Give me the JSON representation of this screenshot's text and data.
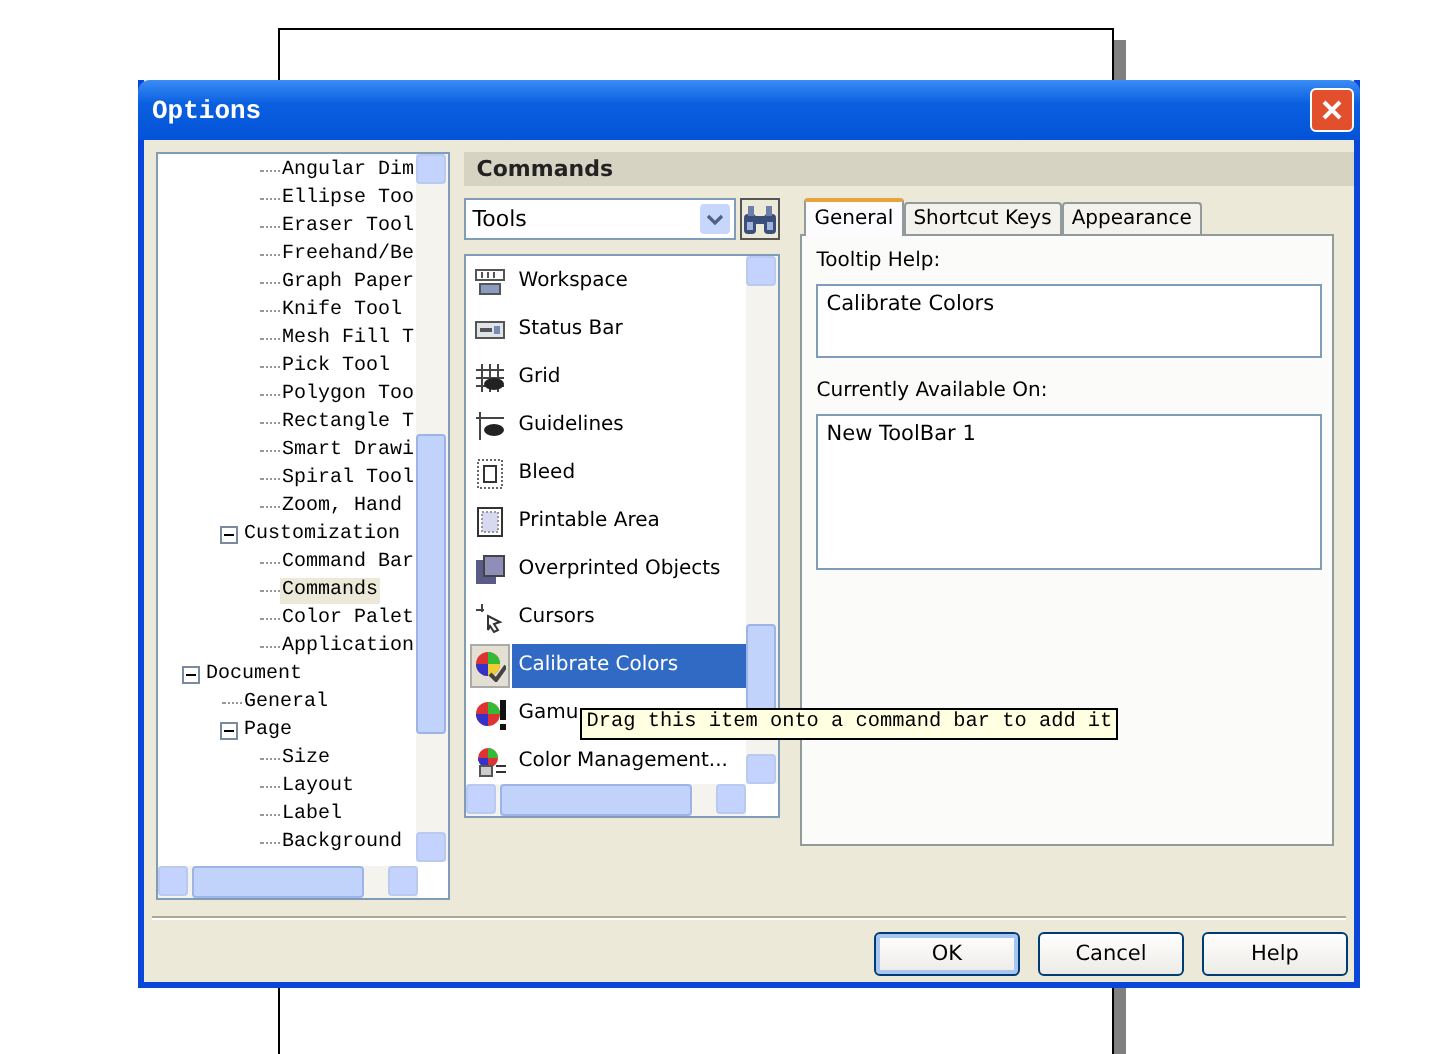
{
  "window": {
    "title": "Options"
  },
  "tree": [
    {
      "children": [
        {
          "children": [
            {
              "label": "Angular Dim",
              "selected": false
            },
            {
              "label": "Ellipse Too",
              "selected": false
            },
            {
              "label": "Eraser Tool",
              "selected": false
            },
            {
              "label": "Freehand/Be",
              "selected": false
            },
            {
              "label": "Graph Paper",
              "selected": false
            },
            {
              "label": "Knife Tool",
              "selected": false
            },
            {
              "label": "Mesh Fill T",
              "selected": false
            },
            {
              "label": "Pick Tool",
              "selected": false
            },
            {
              "label": "Polygon Too",
              "selected": false
            },
            {
              "label": "Rectangle T",
              "selected": false
            },
            {
              "label": "Smart Drawi",
              "selected": false
            },
            {
              "label": "Spiral Tool",
              "selected": false
            },
            {
              "label": "Zoom, Hand",
              "selected": false
            }
          ]
        },
        {
          "label": "Customization",
          "selected": false,
          "expanded": true,
          "children": [
            {
              "label": "Command Bar",
              "selected": false
            },
            {
              "label": "Commands",
              "selected": true
            },
            {
              "label": "Color Palet",
              "selected": false
            },
            {
              "label": "Application",
              "selected": false
            }
          ]
        }
      ]
    },
    {
      "label": "Document",
      "selected": false,
      "expanded": true,
      "children": [
        {
          "label": "General",
          "selected": false
        },
        {
          "label": "Page",
          "selected": false,
          "expanded": true,
          "children": [
            {
              "label": "Size",
              "selected": false
            },
            {
              "label": "Layout",
              "selected": false
            },
            {
              "label": "Label",
              "selected": false
            },
            {
              "label": "Background",
              "selected": false
            }
          ]
        }
      ]
    }
  ],
  "section_title": "Commands",
  "category_dropdown": {
    "value": "Tools"
  },
  "commands": [
    {
      "label": "Workspace",
      "selected": false
    },
    {
      "label": "Status Bar",
      "selected": false
    },
    {
      "label": "Grid",
      "selected": false
    },
    {
      "label": "Guidelines",
      "selected": false
    },
    {
      "label": "Bleed",
      "selected": false
    },
    {
      "label": "Printable Area",
      "selected": false
    },
    {
      "label": "Overprinted Objects",
      "selected": false
    },
    {
      "label": "Cursors",
      "selected": false
    },
    {
      "label": "Calibrate Colors",
      "selected": true
    },
    {
      "label": "Gamu",
      "selected": false
    },
    {
      "label": "Color Management...",
      "selected": false
    }
  ],
  "tooltip": "Drag this item onto a command bar to add it",
  "tabs": [
    {
      "label": "General",
      "selected": true
    },
    {
      "label": "Shortcut Keys",
      "selected": false
    },
    {
      "label": "Appearance",
      "selected": false
    }
  ],
  "tooltip_help": {
    "label": "Tooltip Help:",
    "value": "Calibrate Colors"
  },
  "available_on": {
    "label": "Currently Available On:",
    "items": [
      "New ToolBar 1"
    ]
  },
  "buttons": [
    {
      "label": "OK",
      "default": true
    },
    {
      "label": "Cancel",
      "default": false
    },
    {
      "label": "Help",
      "default": false
    }
  ]
}
